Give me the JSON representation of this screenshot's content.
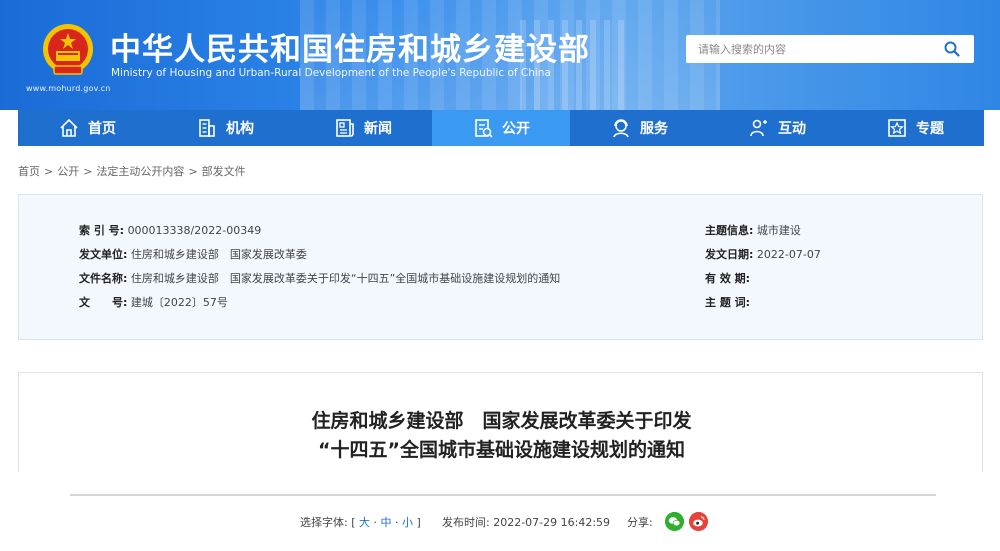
{
  "header": {
    "title": "中华人民共和国住房和城乡建设部",
    "subtitle": "Ministry of Housing and Urban-Rural Development of the People's Republic of China",
    "url": "www.mohurd.gov.cn",
    "search_placeholder": "请输入搜索的内容"
  },
  "nav": {
    "items": [
      {
        "label": "首页",
        "icon": "home-icon"
      },
      {
        "label": "机构",
        "icon": "building-icon"
      },
      {
        "label": "新闻",
        "icon": "news-icon"
      },
      {
        "label": "公开",
        "icon": "document-icon",
        "active": true
      },
      {
        "label": "服务",
        "icon": "service-icon"
      },
      {
        "label": "互动",
        "icon": "interaction-icon"
      },
      {
        "label": "专题",
        "icon": "topic-icon"
      }
    ]
  },
  "breadcrumb": [
    "首页",
    "公开",
    "法定主动公开内容",
    "部发文件"
  ],
  "info": {
    "index_label": "索 引 号:",
    "index_value": "000013338/2022-00349",
    "issuer_label": "发文单位:",
    "issuer_value": "住房和城乡建设部　国家发展改革委",
    "docname_label": "文件名称:",
    "docname_value": "住房和城乡建设部　国家发展改革委关于印发“十四五”全国城市基础设施建设规划的通知",
    "docno_label": "文　　号:",
    "docno_value": "建城〔2022〕57号",
    "topic_label": "主题信息:",
    "topic_value": "城市建设",
    "date_label": "发文日期:",
    "date_value": "2022-07-07",
    "valid_label": "有 效 期:",
    "valid_value": "",
    "keywords_label": "主 题 词:",
    "keywords_value": ""
  },
  "article": {
    "title_line1": "住房和城乡建设部　国家发展改革委关于印发",
    "title_line2": "“十四五”全国城市基础设施建设规划的通知"
  },
  "meta": {
    "font_label": "选择字体:",
    "font_open": "[",
    "font_large": "大",
    "font_medium": "中",
    "font_small": "小",
    "font_close": "]",
    "published_label": "发布时间:",
    "published_value": "2022-07-29 16:42:59",
    "share_label": "分享:"
  }
}
